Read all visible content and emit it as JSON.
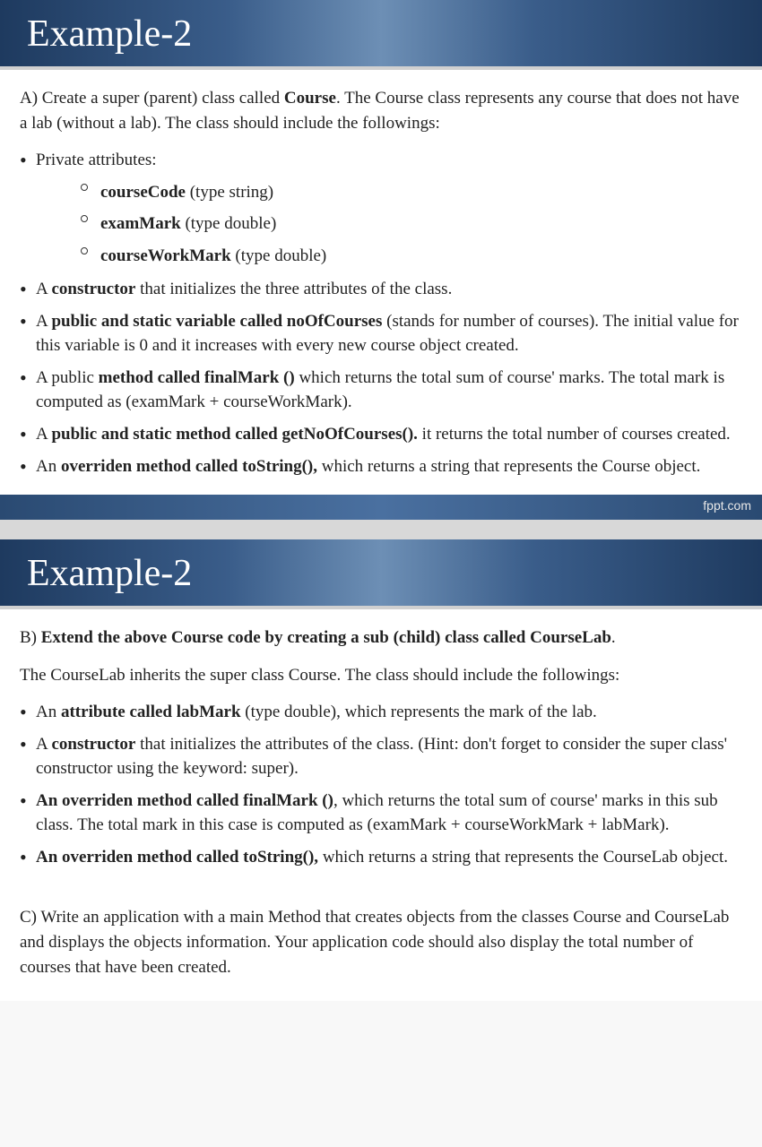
{
  "slide1": {
    "title": "Example-2",
    "intro_a": "A) Create a super (parent) class called ",
    "intro_bold": "Course",
    "intro_b": ". The Course class represents any course that does not have a lab (without a lab).  The class should include the followings:",
    "privAttr": "Private attributes:",
    "attr1_b": "courseCode",
    "attr1_t": " (type string)",
    "attr2_b": "examMark",
    "attr2_t": " (type double)",
    "attr3_b": "courseWorkMark",
    "attr3_t": " (type double)",
    "p2a": "A ",
    "p2b": "constructor",
    "p2c": " that initializes the three attributes of the class.",
    "p3a": "A ",
    "p3b": "public and static variable called noOfCourses",
    "p3c": " (stands for number of courses). The initial value for this variable is 0 and it increases with every new course object created.",
    "p4a": "A public ",
    "p4b": "method called finalMark ()",
    "p4c": " which returns the total sum of course' marks. The total mark is computed as (examMark + courseWorkMark).",
    "p5a": "A ",
    "p5b": "public and static method called getNoOfCourses().",
    "p5c": " it returns the total number of courses created.",
    "p6a": "An ",
    "p6b": "overriden method called toString(),",
    "p6c": " which returns a string that represents the Course object.",
    "footer": "fppt.com"
  },
  "slide2": {
    "title": "Example-2",
    "intro_a": "B) ",
    "intro_b": "Extend the above Course code by creating a sub (child) class called CourseLab",
    "intro_c": ".",
    "sub": "The CourseLab inherits the super class Course. The class should include the followings:",
    "p1a": "An ",
    "p1b": "attribute called labMark",
    "p1c": " (type double), which represents the mark of the lab.",
    "p2a": "A ",
    "p2b": "constructor",
    "p2c": " that initializes the attributes of the class. (Hint: don't forget to consider the super class' constructor using the keyword: super).",
    "p3a": "",
    "p3b": "An overriden method called finalMark ()",
    "p3c": ", which returns the total sum of course' marks in this sub class. The total mark in this case is computed as (examMark + courseWorkMark + labMark).",
    "p4a": "",
    "p4b": "An overriden method called toString(),",
    "p4c": " which returns a string that represents the CourseLab object.",
    "partC": "C) Write an application with a main Method that creates objects from the classes Course and CourseLab and displays the objects information. Your application code should also display the total number of courses that have been created."
  }
}
